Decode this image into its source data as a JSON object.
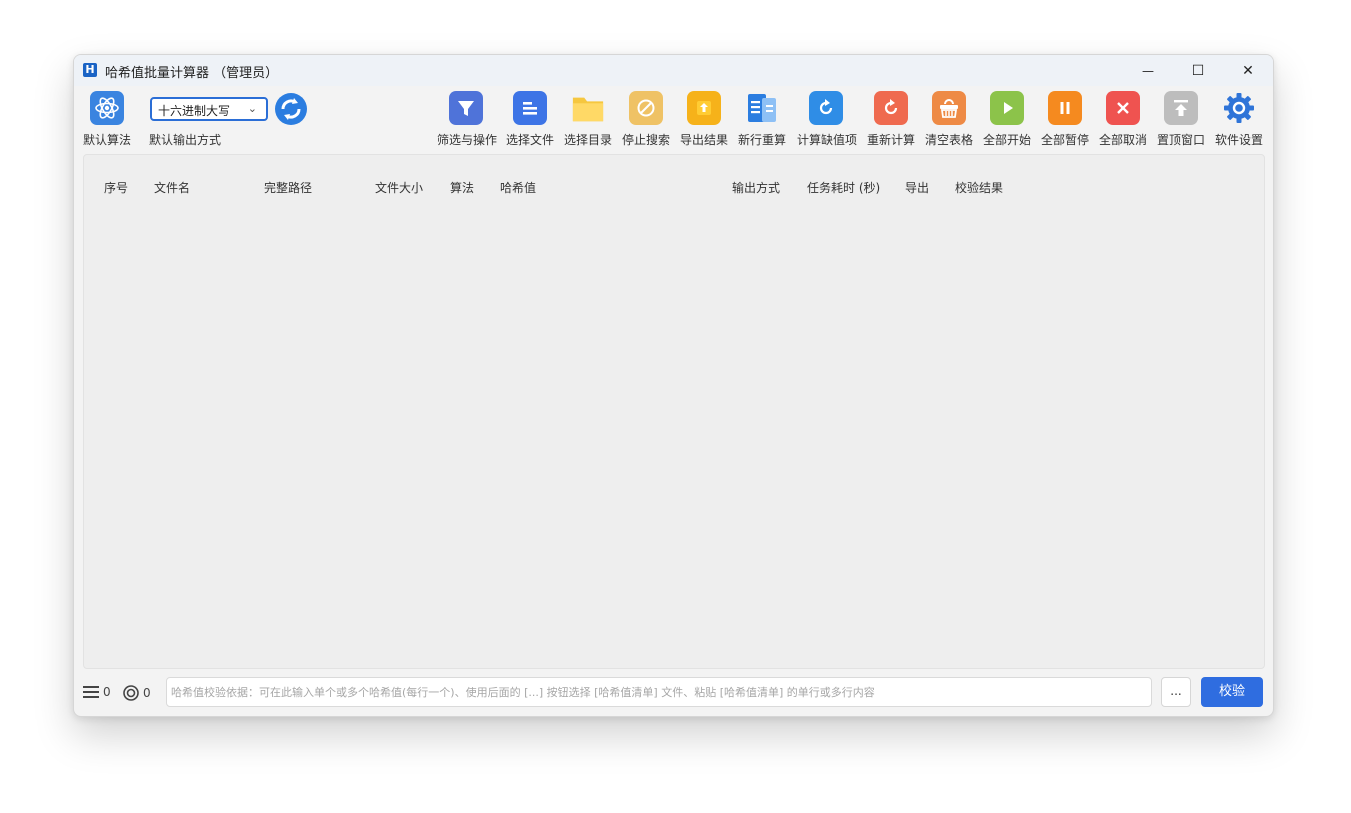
{
  "window": {
    "logo_letter": "H",
    "title": "哈希值批量计算器 （管理员）",
    "controls": {
      "minimize": "—",
      "maximize": "☐",
      "close": "✕"
    }
  },
  "toolbar": {
    "algorithm_label": "默认算法",
    "output_select_value": "十六进制大写",
    "output_label": "默认输出方式",
    "buttons": [
      {
        "label": "筛选与操作",
        "icon": "filter-icon",
        "color": "#4f73d9"
      },
      {
        "label": "选择文件",
        "icon": "file-list-icon",
        "color": "#3d74e6"
      },
      {
        "label": "选择目录",
        "icon": "folder-icon",
        "color": "#f6c73f"
      },
      {
        "label": "停止搜索",
        "icon": "stop-icon",
        "color": "#efc265"
      },
      {
        "label": "导出结果",
        "icon": "export-icon",
        "color": "#f6b21a"
      },
      {
        "label": "新行重算",
        "icon": "new-row-icon",
        "color": "#2b7de0"
      },
      {
        "label": "计算缺值项",
        "icon": "refresh-icon",
        "color": "#2f8de6"
      },
      {
        "label": "重新计算",
        "icon": "recalculate-icon",
        "color": "#ef6a4f"
      },
      {
        "label": "清空表格",
        "icon": "clear-basket-icon",
        "color": "#ee8a45"
      },
      {
        "label": "全部开始",
        "icon": "play-icon",
        "color": "#8cc34a"
      },
      {
        "label": "全部暂停",
        "icon": "pause-icon",
        "color": "#f58a1f"
      },
      {
        "label": "全部取消",
        "icon": "cancel-icon",
        "color": "#ef5350"
      },
      {
        "label": "置顶窗口",
        "icon": "pin-top-icon",
        "color": "#bdbdbd"
      },
      {
        "label": "软件设置",
        "icon": "gear-icon",
        "color": "#2f74d8"
      }
    ]
  },
  "table": {
    "columns": [
      "序号",
      "文件名",
      "完整路径",
      "文件大小",
      "算法",
      "哈希值",
      "输出方式",
      "任务耗时 (秒)",
      "导出",
      "校验结果"
    ]
  },
  "status": {
    "list_count": "0",
    "target_count": "0",
    "hash_placeholder": "哈希值校验依据：可在此输入单个或多个哈希值(每行一个)、使用后面的 [...] 按钮选择 [哈希值清单] 文件、粘贴 [哈希值清单] 的单行或多行内容",
    "browse_label": "...",
    "verify_label": "校验"
  }
}
